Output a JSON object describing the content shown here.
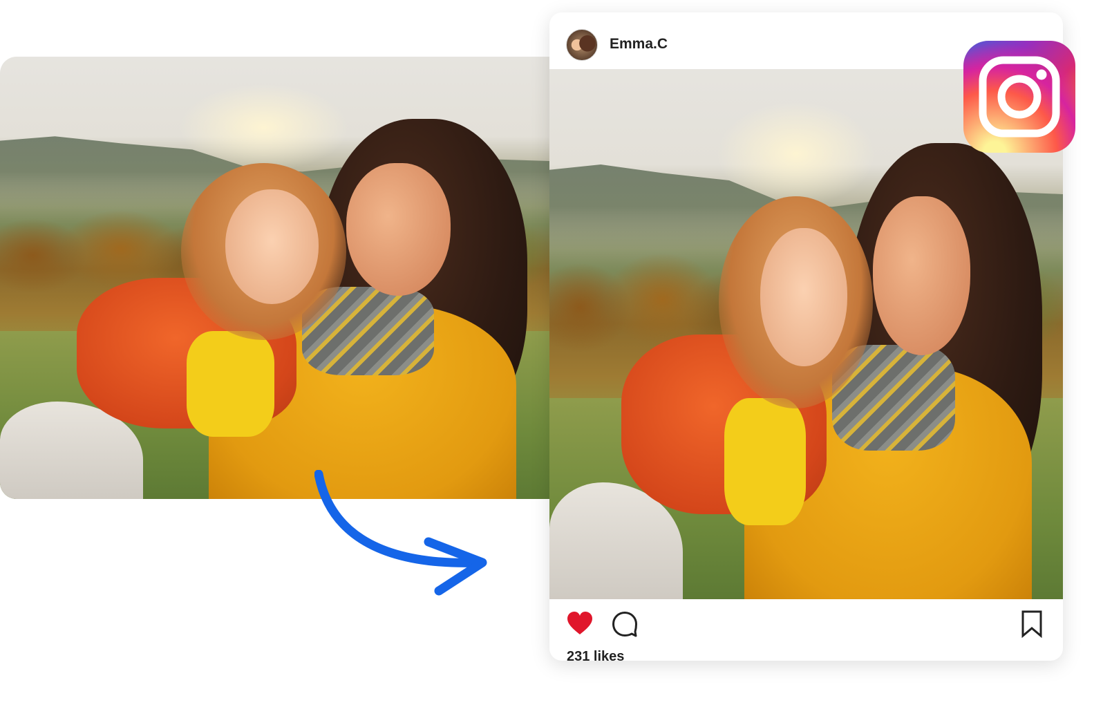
{
  "post": {
    "username": "Emma.C",
    "likes": "231 likes"
  },
  "icons": {
    "heart": "heart-icon",
    "comment": "comment-icon",
    "bookmark": "bookmark-icon",
    "logo": "instagram-logo-icon",
    "arrow": "curved-arrow-icon"
  },
  "colors": {
    "heart": "#e0162b",
    "arrow": "#1565e8",
    "text": "#222222"
  }
}
